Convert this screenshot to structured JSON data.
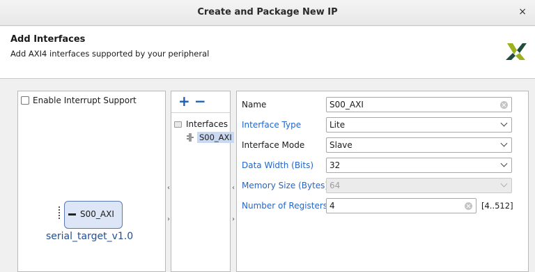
{
  "window": {
    "title": "Create and Package New IP",
    "close_symbol": "×"
  },
  "header": {
    "title": "Add Interfaces",
    "subtitle": "Add AXI4 interfaces supported by your peripheral",
    "logo_icon": "xilinx-logo-icon"
  },
  "left_panel": {
    "enable_interrupt_label": "Enable Interrupt Support",
    "enable_interrupt_checked": false,
    "port_label": "S00_AXI",
    "ip_name": "serial_target_v1.0"
  },
  "splitters": {
    "left_arrow": "‹",
    "right_arrow": "›"
  },
  "interfaces_panel": {
    "add_symbol": "+",
    "remove_symbol": "−",
    "folder_label": "Interfaces",
    "items": [
      {
        "label": "S00_AXI",
        "selected": true
      }
    ]
  },
  "properties": {
    "name": {
      "label": "Name",
      "value": "S00_AXI"
    },
    "interface_type": {
      "label": "Interface Type",
      "value": "Lite"
    },
    "interface_mode": {
      "label": "Interface Mode",
      "value": "Slave"
    },
    "data_width": {
      "label": "Data Width (Bits)",
      "value": "32"
    },
    "memory_size": {
      "label": "Memory Size (Bytes)",
      "value": "64",
      "disabled": true
    },
    "num_registers": {
      "label": "Number of Registers",
      "value": "4",
      "range": "[4..512]"
    }
  },
  "colors": {
    "accent_blue": "#2565c7",
    "selection": "#c9d9f3",
    "logo_green": "#9bb11e"
  }
}
